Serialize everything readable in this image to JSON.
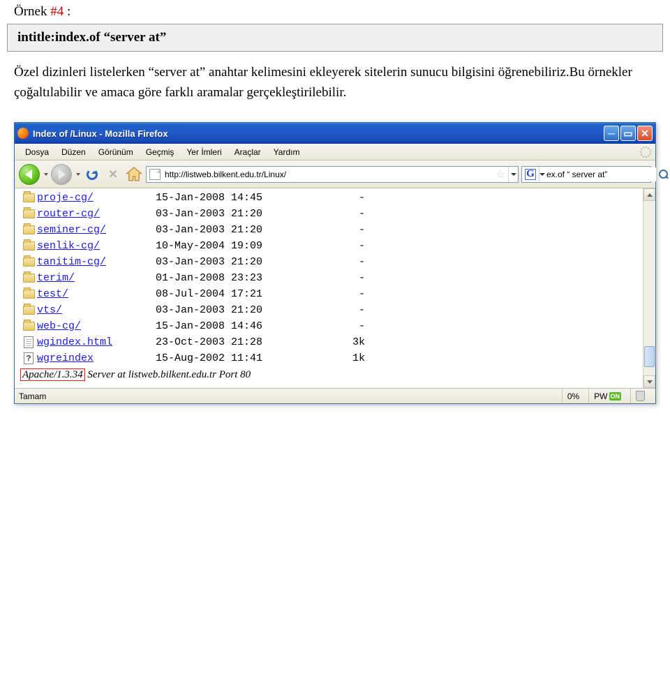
{
  "heading": {
    "prefix": "Örnek ",
    "num": "#4",
    "suffix": " :"
  },
  "query_text": "intitle:index.of “server at”",
  "paragraph": "Özel dizinleri listelerken “server at” anahtar kelimesini ekleyerek sitelerin sunucu bilgisini öğrenebiliriz.Bu örnekler çoğaltılabilir ve amaca göre farklı aramalar gerçekleştirilebilir.",
  "browser": {
    "title": "Index of /Linux - Mozilla Firefox",
    "menu": [
      "Dosya",
      "Düzen",
      "Görünüm",
      "Geçmiş",
      "Yer İmleri",
      "Araçlar",
      "Yardım"
    ],
    "url": "http://listweb.bilkent.edu.tr/Linux/",
    "search_engine_glyph": "G",
    "search_value": "ex.of “ server at”"
  },
  "listing": [
    {
      "icon": "folder",
      "name": "proje-cg/",
      "date": "15-Jan-2008 14:45",
      "size": "-"
    },
    {
      "icon": "folder",
      "name": "router-cg/",
      "date": "03-Jan-2003 21:20",
      "size": "-"
    },
    {
      "icon": "folder",
      "name": "seminer-cg/",
      "date": "03-Jan-2003 21:20",
      "size": "-"
    },
    {
      "icon": "folder",
      "name": "senlik-cg/",
      "date": "10-May-2004 19:09",
      "size": "-"
    },
    {
      "icon": "folder",
      "name": "tanitim-cg/",
      "date": "03-Jan-2003 21:20",
      "size": "-"
    },
    {
      "icon": "folder",
      "name": "terim/",
      "date": "01-Jan-2008 23:23",
      "size": "-"
    },
    {
      "icon": "folder",
      "name": "test/",
      "date": "08-Jul-2004 17:21",
      "size": "-"
    },
    {
      "icon": "folder",
      "name": "vts/",
      "date": "03-Jan-2003 21:20",
      "size": "-"
    },
    {
      "icon": "folder",
      "name": "web-cg/",
      "date": "15-Jan-2008 14:46",
      "size": "-"
    },
    {
      "icon": "file",
      "name": "wgindex.html",
      "date": "23-Oct-2003 21:28",
      "size": "3k"
    },
    {
      "icon": "unknown",
      "name": "wgreindex",
      "date": "15-Aug-2002 11:41",
      "size": "1k"
    }
  ],
  "server_line": {
    "version": "Apache/1.3.34",
    "rest": " Server at listweb.bilkent.edu.tr Port 80"
  },
  "status": {
    "text": "Tamam",
    "percent": "0%",
    "pw": "PW",
    "on": "ON"
  }
}
